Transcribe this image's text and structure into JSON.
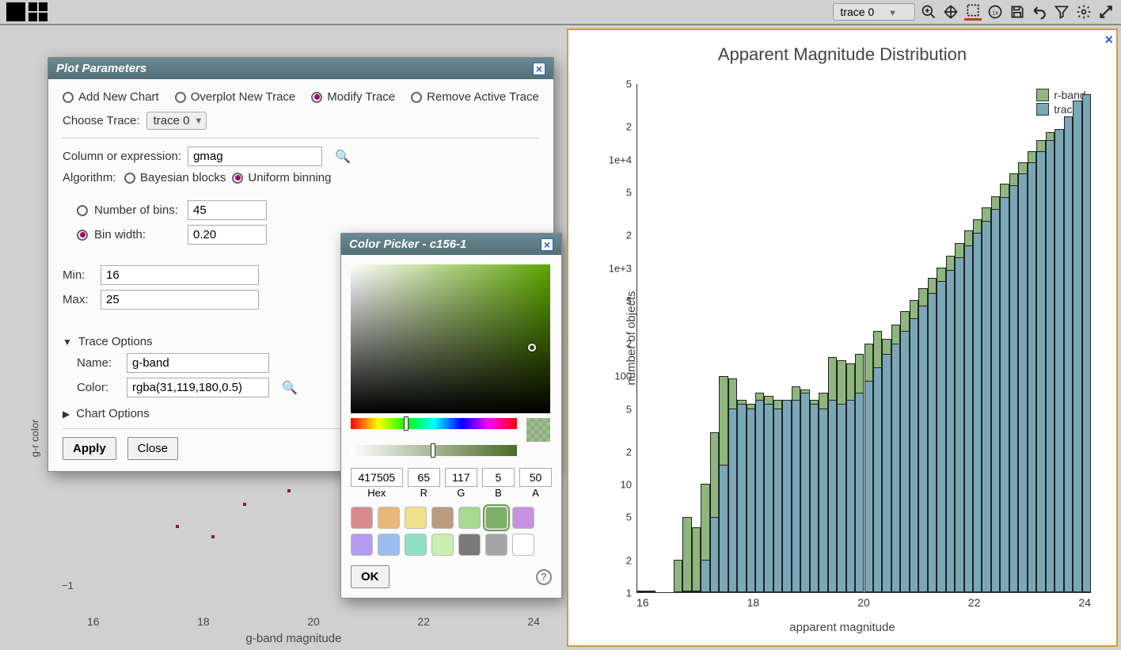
{
  "toolbar": {
    "trace_select": "trace 0",
    "icons": [
      "zoom-in",
      "pan",
      "select-box",
      "one-to-one",
      "save",
      "undo",
      "filter",
      "settings",
      "expand"
    ]
  },
  "plot_params": {
    "title": "Plot Parameters",
    "radios": {
      "add": "Add New Chart",
      "overplot": "Overplot New Trace",
      "modify": "Modify Trace",
      "remove": "Remove Active Trace",
      "selected": "modify"
    },
    "choose_trace_label": "Choose Trace:",
    "choose_trace_value": "trace 0",
    "column_label": "Column or expression:",
    "column_value": "gmag",
    "algorithm_label": "Algorithm:",
    "algo_bayesian": "Bayesian blocks",
    "algo_uniform": "Uniform binning",
    "algo_selected": "uniform",
    "nbins_label": "Number of bins:",
    "nbins_value": "45",
    "binwidth_label": "Bin width:",
    "binwidth_value": "0.20",
    "binmode_selected": "width",
    "min_label": "Min:",
    "min_value": "16",
    "max_label": "Max:",
    "max_value": "25",
    "trace_options": "Trace Options",
    "name_label": "Name:",
    "name_value": "g-band",
    "color_label": "Color:",
    "color_value": "rgba(31,119,180,0.5)",
    "chart_options": "Chart Options",
    "apply": "Apply",
    "close": "Close"
  },
  "color_picker": {
    "title": "Color Picker - c156-1",
    "hex_label": "Hex",
    "hex": "417505",
    "r_label": "R",
    "r": "65",
    "g_label": "G",
    "g": "117",
    "b_label": "B",
    "b": "5",
    "a_label": "A",
    "a": "50",
    "ok": "OK",
    "swatches": [
      "#d98b8b",
      "#e8b878",
      "#efe28a",
      "#b99b7e",
      "#a7d98f",
      "#7fb06a",
      "#c792e0",
      "#b49cf0",
      "#9cbdf0",
      "#8fe0c7",
      "#c7efb0",
      "#7a7a7a",
      "#a5a5a5",
      "#ffffff"
    ],
    "selected_swatch": 5
  },
  "bg_chart": {
    "ylabel": "g-r color",
    "xlabel": "g-band magnitude",
    "xticks": [
      "16",
      "18",
      "20",
      "22",
      "24"
    ],
    "ytick": "−1"
  },
  "chart_data": {
    "type": "bar",
    "title": "Apparent Magnitude Distribution",
    "xlabel": "apparent magnitude",
    "ylabel": "number of objects",
    "yscale": "log",
    "ylim": [
      1,
      50000
    ],
    "xlim": [
      15,
      25
    ],
    "xticks": [
      "16",
      "18",
      "20",
      "22",
      "24"
    ],
    "yticks_major": [
      "1",
      "10",
      "100",
      "1e+3",
      "1e+4"
    ],
    "yticks_minor": [
      "2",
      "5",
      "2",
      "5",
      "2",
      "5",
      "2",
      "5",
      "2",
      "5"
    ],
    "legend": [
      {
        "name": "r-band",
        "color": "#8db77e"
      },
      {
        "name": "trace 0",
        "color": "#7aa8b8"
      }
    ],
    "bin_width": 0.2,
    "categories": [
      15.0,
      15.2,
      15.4,
      15.6,
      15.8,
      16.0,
      16.2,
      16.4,
      16.6,
      16.8,
      17.0,
      17.2,
      17.4,
      17.6,
      17.8,
      18.0,
      18.2,
      18.4,
      18.6,
      18.8,
      19.0,
      19.2,
      19.4,
      19.6,
      19.8,
      20.0,
      20.2,
      20.4,
      20.6,
      20.8,
      21.0,
      21.2,
      21.4,
      21.6,
      21.8,
      22.0,
      22.2,
      22.4,
      22.6,
      22.8,
      23.0,
      23.2,
      23.4,
      23.6,
      23.8,
      24.0,
      24.2,
      24.4,
      24.6,
      24.8
    ],
    "series": [
      {
        "name": "r-band",
        "values": [
          1,
          1,
          0,
          0,
          2,
          5,
          4,
          10,
          30,
          100,
          95,
          60,
          55,
          70,
          65,
          60,
          55,
          80,
          75,
          60,
          70,
          150,
          140,
          130,
          160,
          200,
          260,
          220,
          300,
          400,
          500,
          650,
          800,
          1000,
          1300,
          1700,
          2200,
          2800,
          3600,
          4600,
          6000,
          7500,
          9500,
          12000,
          15000,
          18000,
          19000,
          20000,
          22000,
          21000
        ]
      },
      {
        "name": "trace 0",
        "values": [
          0,
          0,
          0,
          0,
          0,
          1,
          1,
          2,
          5,
          15,
          50,
          55,
          50,
          60,
          55,
          50,
          60,
          60,
          70,
          55,
          50,
          60,
          55,
          60,
          70,
          90,
          120,
          160,
          200,
          260,
          340,
          450,
          580,
          750,
          950,
          1250,
          1600,
          2100,
          2700,
          3500,
          4500,
          5800,
          7500,
          9500,
          12000,
          15000,
          19000,
          25000,
          35000,
          40000
        ]
      }
    ]
  }
}
